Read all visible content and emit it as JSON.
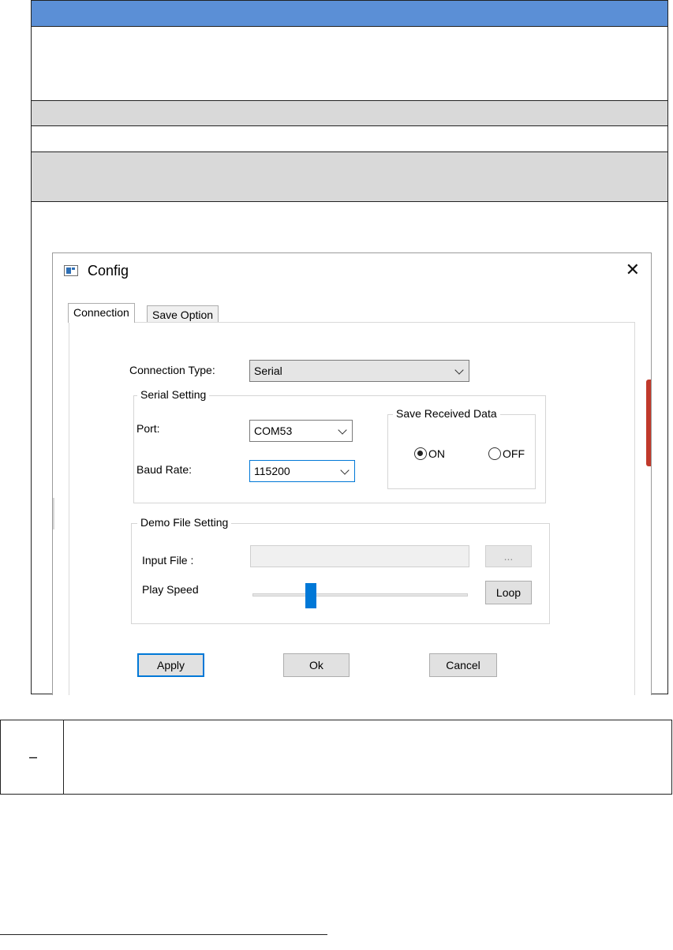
{
  "dialog": {
    "title": "Config",
    "close_glyph": "✕",
    "tabs": [
      {
        "label": "Connection",
        "active": true
      },
      {
        "label": "Save Option",
        "active": false
      }
    ],
    "connection_type": {
      "label": "Connection Type:",
      "value": "Serial"
    },
    "serial_setting": {
      "title": "Serial Setting",
      "port": {
        "label": "Port:",
        "value": "COM53"
      },
      "baud_rate": {
        "label": "Baud Rate:",
        "value": "115200"
      }
    },
    "save_received_data": {
      "title": "Save Received Data",
      "on_label": "ON",
      "off_label": "OFF",
      "selected": "ON"
    },
    "demo_file_setting": {
      "title": "Demo File Setting",
      "input_file_label": "Input File :",
      "browse_label": "...",
      "play_speed_label": "Play Speed",
      "play_speed_level": 0.27,
      "loop_label": "Loop"
    },
    "buttons": {
      "apply": "Apply",
      "ok": "Ok",
      "cancel": "Cancel"
    },
    "accent_color": "#0078d7"
  },
  "table": {
    "header_color": "#5b8fd6",
    "shaded_row_color": "#d9d9d9"
  },
  "note": {
    "mark": "–"
  }
}
